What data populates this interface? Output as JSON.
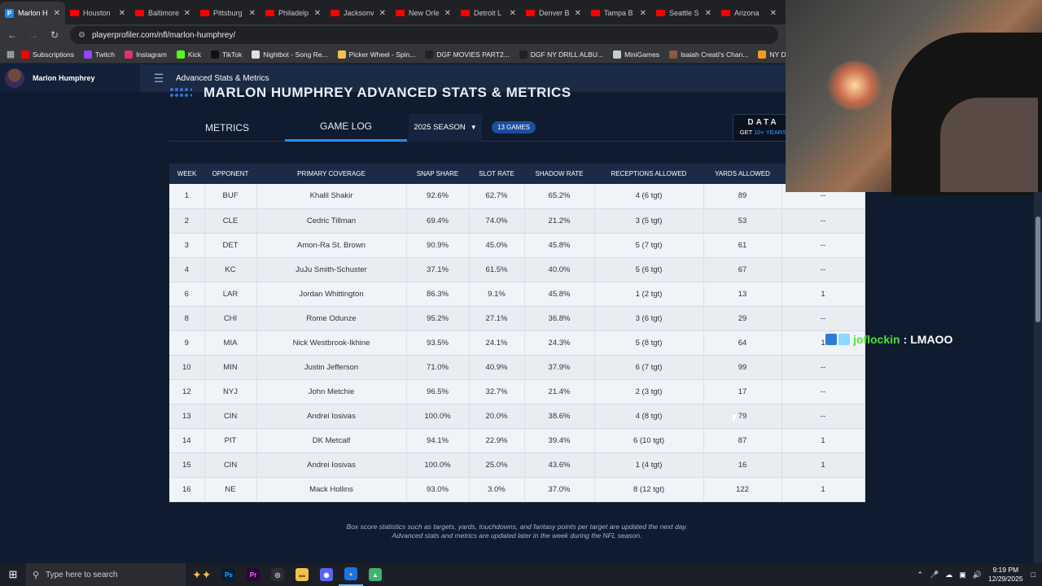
{
  "browser": {
    "tabs": [
      {
        "title": "Marlon H",
        "icon": "playerprofiler-icon",
        "active": true
      },
      {
        "title": "Houston",
        "icon": "youtube-icon"
      },
      {
        "title": "Baltimore",
        "icon": "youtube-icon"
      },
      {
        "title": "Pittsburg",
        "icon": "youtube-icon"
      },
      {
        "title": "Philadelp",
        "icon": "youtube-icon"
      },
      {
        "title": "Jacksonv",
        "icon": "youtube-icon"
      },
      {
        "title": "New Orle",
        "icon": "youtube-icon"
      },
      {
        "title": "Detroit L",
        "icon": "youtube-icon"
      },
      {
        "title": "Denver B",
        "icon": "youtube-icon"
      },
      {
        "title": "Tampa B",
        "icon": "youtube-icon"
      },
      {
        "title": "Seattle S",
        "icon": "youtube-icon"
      },
      {
        "title": "Arizona",
        "icon": "youtube-icon"
      }
    ],
    "url": "playerprofiler.com/nfl/marlon-humphrey/",
    "bookmarks": [
      {
        "label": "Subscriptions",
        "color": "#ff0000"
      },
      {
        "label": "Twitch",
        "color": "#9146ff"
      },
      {
        "label": "Instagram",
        "color": "#e1306c"
      },
      {
        "label": "Kick",
        "color": "#53fc18"
      },
      {
        "label": "TikTok",
        "color": "#111111"
      },
      {
        "label": "Nightbot - Song Re...",
        "color": "#e0e0e0"
      },
      {
        "label": "Picker Wheel - Spin...",
        "color": "#f2c14e"
      },
      {
        "label": "DGF MOVIES PART2...",
        "color": "#222222"
      },
      {
        "label": "DGF NY DRILL ALBU...",
        "color": "#222222"
      },
      {
        "label": "MiniGames",
        "color": "#c6c9ce"
      },
      {
        "label": "Isaiah Creati's Chan...",
        "color": "#8a5a3a"
      },
      {
        "label": "NY Drill Deads Q",
        "color": "#f29a1e"
      }
    ]
  },
  "site": {
    "player_name": "Marlon Humphrey",
    "header_title": "Advanced Stats & Metrics",
    "page_title": "MARLON HUMPHREY ADVANCED STATS & METRICS",
    "tabs": {
      "metrics": "METRICS",
      "game_log": "GAME LOG"
    },
    "season": "2025 SEASON",
    "games_pill": "13 GAMES",
    "data_badge": {
      "line1": "DATA",
      "line2_prefix": "GET ",
      "line2_highlight": "10+ YEARS"
    }
  },
  "table": {
    "columns": [
      "WEEK",
      "OPPONENT",
      "PRIMARY COVERAGE",
      "SNAP SHARE",
      "SLOT RATE",
      "SHADOW RATE",
      "RECEPTIONS ALLOWED",
      "YARDS ALLOWED",
      ""
    ],
    "rows": [
      [
        "1",
        "BUF",
        "Khalil Shakir",
        "92.6%",
        "62.7%",
        "65.2%",
        "4 (6 tgt)",
        "89",
        "--"
      ],
      [
        "2",
        "CLE",
        "Cedric Tillman",
        "69.4%",
        "74.0%",
        "21.2%",
        "3 (5 tgt)",
        "53",
        "--"
      ],
      [
        "3",
        "DET",
        "Amon-Ra St. Brown",
        "90.9%",
        "45.0%",
        "45.8%",
        "5 (7 tgt)",
        "61",
        "--"
      ],
      [
        "4",
        "KC",
        "JuJu Smith-Schuster",
        "37.1%",
        "61.5%",
        "40.0%",
        "5 (6 tgt)",
        "67",
        "--"
      ],
      [
        "6",
        "LAR",
        "Jordan Whittington",
        "86.3%",
        "9.1%",
        "45.8%",
        "1 (2 tgt)",
        "13",
        "1"
      ],
      [
        "8",
        "CHI",
        "Rome Odunze",
        "95.2%",
        "27.1%",
        "36.8%",
        "3 (6 tgt)",
        "29",
        "--"
      ],
      [
        "9",
        "MIA",
        "Nick Westbrook-Ikhine",
        "93.5%",
        "24.1%",
        "24.3%",
        "5 (8 tgt)",
        "64",
        "1"
      ],
      [
        "10",
        "MIN",
        "Justin Jefferson",
        "71.0%",
        "40.9%",
        "37.9%",
        "6 (7 tgt)",
        "99",
        "--"
      ],
      [
        "12",
        "NYJ",
        "John Metchie",
        "96.5%",
        "32.7%",
        "21.4%",
        "2 (3 tgt)",
        "17",
        "--"
      ],
      [
        "13",
        "CIN",
        "Andrei Iosivas",
        "100.0%",
        "20.0%",
        "38.6%",
        "4 (8 tgt)",
        "79",
        "--"
      ],
      [
        "14",
        "PIT",
        "DK Metcalf",
        "94.1%",
        "22.9%",
        "39.4%",
        "6 (10 tgt)",
        "87",
        "1"
      ],
      [
        "15",
        "CIN",
        "Andrei Iosivas",
        "100.0%",
        "25.0%",
        "43.6%",
        "1 (4 tgt)",
        "16",
        "1"
      ],
      [
        "16",
        "NE",
        "Mack Hollins",
        "93.0%",
        "3.0%",
        "37.0%",
        "8 (12 tgt)",
        "122",
        "1"
      ]
    ]
  },
  "footnote": {
    "line1": "Box score statistics such as targets, yards, touchdowns, and fantasy points per target are updated the next day.",
    "line2": "Advanced stats and metrics are updated later in the week during the NFL season."
  },
  "chat": {
    "user": "joflockin",
    "separator": ":",
    "message": "LMAOO"
  },
  "taskbar": {
    "search_placeholder": "Type here to search",
    "apps": [
      {
        "label": "Ps",
        "bg": "#001e36",
        "fg": "#31a8ff"
      },
      {
        "label": "Pr",
        "bg": "#2a0634",
        "fg": "#ea77ff"
      },
      {
        "label": "◎",
        "bg": "#2b2d33",
        "fg": "#d0d0d0"
      },
      {
        "label": "▬",
        "bg": "#f2c14e",
        "fg": "#8a6a1a"
      },
      {
        "label": "◉",
        "bg": "#5865f2",
        "fg": "#ffffff"
      },
      {
        "label": "●",
        "bg": "#1a73e8",
        "fg": "#fbbc04"
      },
      {
        "label": "▲",
        "bg": "#3cb371",
        "fg": "#ffffff"
      }
    ],
    "time": "9:19 PM",
    "date": "12/29/2025"
  }
}
